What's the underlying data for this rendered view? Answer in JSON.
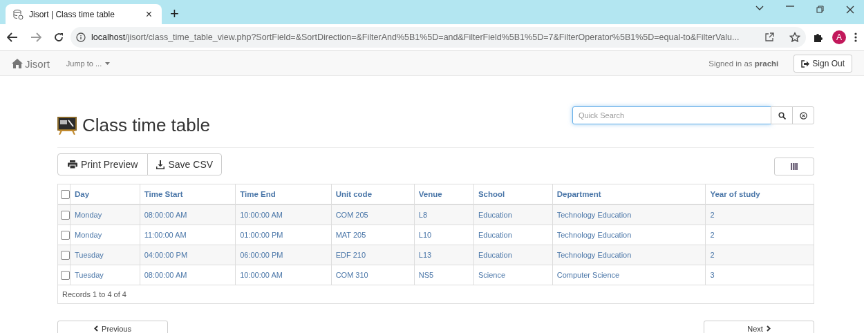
{
  "browser": {
    "tab_title": "Jisort | Class time table",
    "close": "×",
    "new_tab": "+",
    "url_host": "localhost",
    "url_path": "/jisort/class_time_table_view.php?SortField=&SortDirection=&FilterAnd%5B1%5D=and&FilterField%5B1%5D=7&FilterOperator%5B1%5D=equal-to&FilterValu...",
    "profile": "A"
  },
  "navbar": {
    "brand": "Jisort",
    "jump": "Jump to ...",
    "signed_in_prefix": "Signed in as ",
    "user": "prachi",
    "sign_out": "Sign Out"
  },
  "page": {
    "title": "Class time table",
    "search": {
      "placeholder": "Quick Search"
    },
    "buttons": [
      "Print Preview",
      "Save CSV"
    ]
  },
  "table": {
    "select_all": {
      "checked": false
    },
    "columns": [
      "Day",
      "Time Start",
      "Time End",
      "Unit code",
      "Venue",
      "School",
      "Department",
      "Year of study"
    ],
    "rows": [
      {
        "checked": false,
        "cells": [
          "Monday",
          "08:00:00 AM",
          "10:00:00 AM",
          "COM 205",
          "L8",
          "Education",
          "Technology Education",
          "2"
        ]
      },
      {
        "checked": false,
        "cells": [
          "Monday",
          "11:00:00 AM",
          "01:00:00 PM",
          "MAT 205",
          "L10",
          "Education",
          "Technology Education",
          "2"
        ]
      },
      {
        "checked": false,
        "cells": [
          "Tuesday",
          "04:00:00 PM",
          "06:00:00 PM",
          "EDF 210",
          "L13",
          "Education",
          "Technology Education",
          "2"
        ]
      },
      {
        "checked": false,
        "cells": [
          "Tuesday",
          "08:00:00 AM",
          "10:00:00 AM",
          "COM 310",
          "NS5",
          "Science",
          "Computer Science",
          "3"
        ]
      }
    ],
    "footer": "Records 1 to 4 of 4"
  },
  "pager": {
    "previous": "Previous",
    "next": "Next"
  }
}
